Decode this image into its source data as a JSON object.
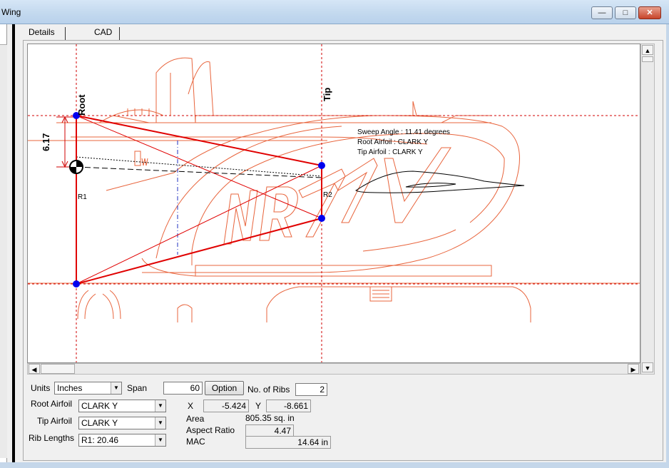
{
  "window": {
    "title": "Wing"
  },
  "tabs": [
    {
      "label": "Details"
    },
    {
      "label": "CAD"
    }
  ],
  "drawing": {
    "root_label": "Root",
    "tip_label": "Tip",
    "dimension": "6.17",
    "rib_labels": [
      "R1",
      "R2"
    ],
    "info": {
      "sweep_angle": "Sweep Angle : 11.41 degrees",
      "root_airfoil": "Root Airfoil : CLARK Y",
      "tip_airfoil": "Tip Airfoil   : CLARK Y"
    },
    "background_text": "NR77V",
    "colors": {
      "wing_outline": "#e00000",
      "background_plan": "#e8643c",
      "guide_lines": "#d00000",
      "points": "#0000ee"
    }
  },
  "controls": {
    "units_label": "Units",
    "units_value": "Inches",
    "span_label": "Span",
    "span_value": "60",
    "option_button": "Option",
    "ribs_label": "No. of Ribs",
    "ribs_value": "2",
    "root_airfoil_label": "Root Airfoil",
    "root_airfoil_value": "CLARK Y",
    "tip_airfoil_label": "Tip Airfoil",
    "tip_airfoil_value": "CLARK Y",
    "rib_lengths_label": "Rib Lengths",
    "rib_lengths_value": "R1: 20.46",
    "x_label": "X",
    "x_value": "-5.424",
    "y_label": "Y",
    "y_value": "-8.661",
    "area_label": "Area",
    "area_value": "805.35 sq. in",
    "aspect_label": "Aspect Ratio",
    "aspect_value": "4.47",
    "mac_label": "MAC",
    "mac_value": "14.64 in"
  }
}
